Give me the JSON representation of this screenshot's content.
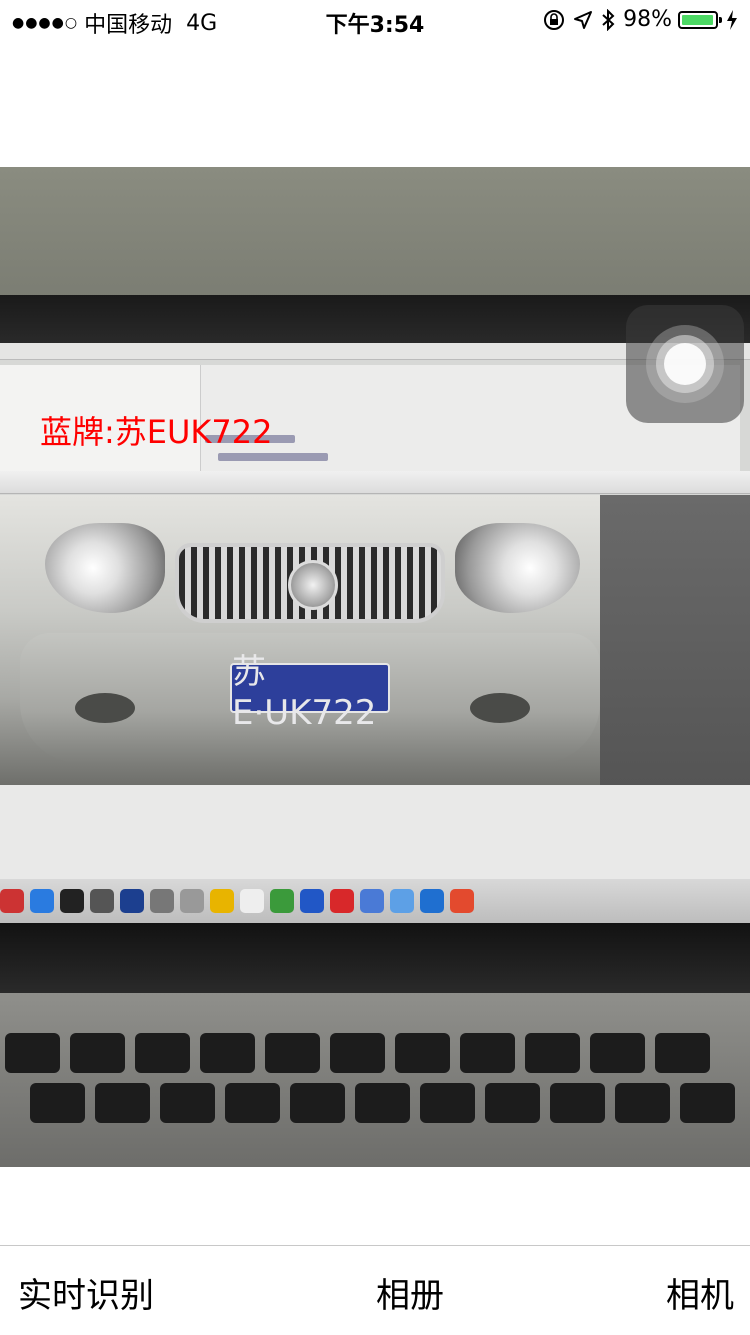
{
  "status_bar": {
    "signal_dots": "●●●●○",
    "carrier": "中国移动",
    "network": "4G",
    "time": "下午3:54",
    "battery_percent": "98%",
    "battery_level": 0.98,
    "icons": [
      "rotation-lock-icon",
      "location-icon",
      "bluetooth-icon",
      "battery-icon",
      "charging-icon"
    ]
  },
  "recognition": {
    "result_text": "蓝牌:苏EUK722",
    "color": "#ff0000"
  },
  "camera_preview": {
    "plate_text": "苏E·UK722",
    "plate_color": "#2d3f9b"
  },
  "tab_bar": {
    "realtime_label": "实时识别",
    "album_label": "相册",
    "camera_label": "相机"
  }
}
